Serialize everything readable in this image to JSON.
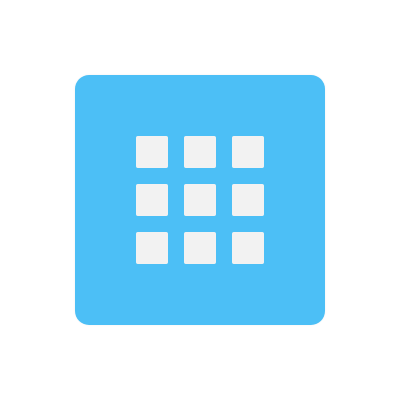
{
  "icon": {
    "name": "apps-grid-icon",
    "tile_color": "#4cbff6",
    "cell_color": "#f2f2f2",
    "rows": 3,
    "columns": 3
  }
}
